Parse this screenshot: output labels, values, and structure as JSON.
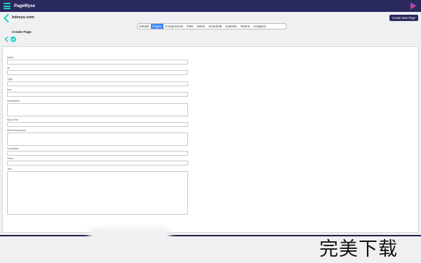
{
  "app": {
    "brand": "PageWyse"
  },
  "site": {
    "name": "bdesys.com",
    "create_button": "Create New Page"
  },
  "tabs": [
    {
      "label": "Details",
      "active": false
    },
    {
      "label": "Pages",
      "active": true
    },
    {
      "label": "Components",
      "active": false
    },
    {
      "label": "Files",
      "active": false
    },
    {
      "label": "Notes",
      "active": false
    },
    {
      "label": "Schedule",
      "active": false
    },
    {
      "label": "Submits",
      "active": false
    },
    {
      "label": "Teams",
      "active": false
    },
    {
      "label": "Analytics",
      "active": false
    }
  ],
  "page": {
    "title": "Create Page"
  },
  "form": {
    "fields": [
      {
        "label": "Name",
        "value": "",
        "type": "input"
      },
      {
        "label": "url",
        "value": "",
        "type": "input"
      },
      {
        "label": "Type",
        "value": "",
        "type": "input"
      },
      {
        "label": "Key",
        "value": "",
        "type": "input"
      },
      {
        "label": "Description",
        "value": "",
        "type": "textarea"
      },
      {
        "label": "Meta Title",
        "value": "",
        "type": "input"
      },
      {
        "label": "Meta Description",
        "value": "",
        "type": "textarea"
      },
      {
        "label": "Canonical",
        "value": "",
        "type": "input"
      },
      {
        "label": "Head",
        "value": "",
        "type": "input"
      },
      {
        "label": "Text",
        "value": "",
        "type": "textarea"
      }
    ]
  },
  "watermark": "完美下载",
  "colors": {
    "topbar": "#2b2a5e",
    "accent": "#1fd1c2",
    "tab_active": "#3a86ff"
  }
}
